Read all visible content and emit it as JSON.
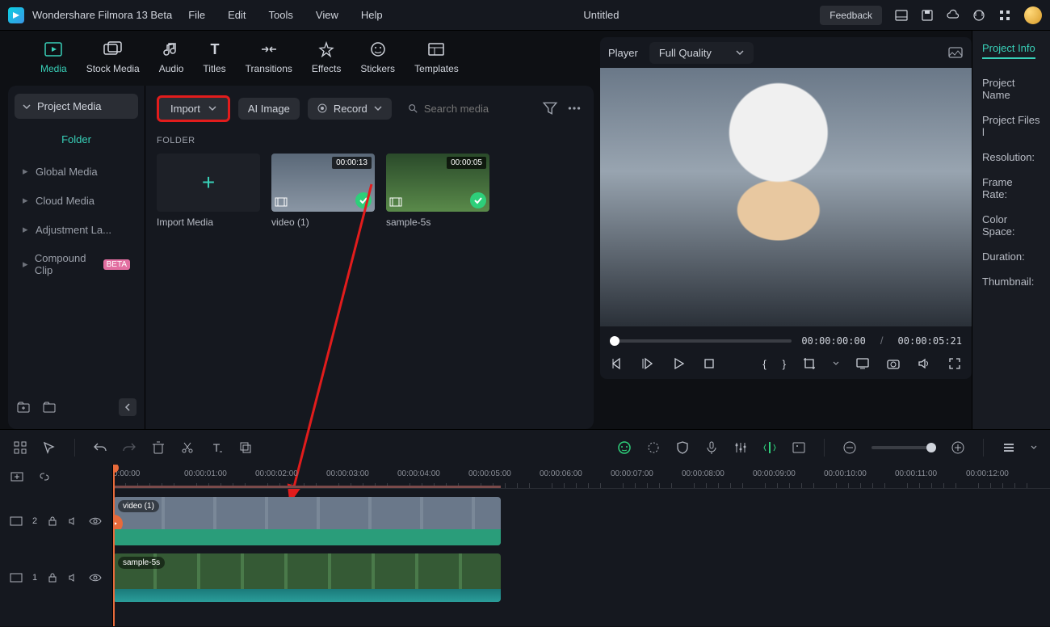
{
  "titlebar": {
    "app_name": "Wondershare Filmora 13 Beta",
    "menus": [
      "File",
      "Edit",
      "Tools",
      "View",
      "Help"
    ],
    "document_title": "Untitled",
    "feedback_label": "Feedback"
  },
  "category_tabs": {
    "items": [
      {
        "id": "media",
        "label": "Media",
        "active": true
      },
      {
        "id": "stock",
        "label": "Stock Media"
      },
      {
        "id": "audio",
        "label": "Audio"
      },
      {
        "id": "titles",
        "label": "Titles"
      },
      {
        "id": "transitions",
        "label": "Transitions"
      },
      {
        "id": "effects",
        "label": "Effects"
      },
      {
        "id": "stickers",
        "label": "Stickers"
      },
      {
        "id": "templates",
        "label": "Templates"
      }
    ]
  },
  "media_sidebar": {
    "project_media_label": "Project Media",
    "folder_label": "Folder",
    "items": [
      {
        "label": "Global Media"
      },
      {
        "label": "Cloud Media"
      },
      {
        "label": "Adjustment La..."
      },
      {
        "label": "Compound Clip",
        "beta": true
      }
    ]
  },
  "media_toolbar": {
    "import_label": "Import",
    "ai_image_label": "AI Image",
    "record_label": "Record",
    "search_placeholder": "Search media"
  },
  "folder_header": "FOLDER",
  "thumbs": {
    "import_media_label": "Import Media",
    "video1": {
      "label": "video (1)",
      "duration": "00:00:13"
    },
    "sample": {
      "label": "sample-5s",
      "duration": "00:00:05"
    }
  },
  "player": {
    "label": "Player",
    "quality_label": "Full Quality",
    "current_time": "00:00:00:00",
    "total_time": "00:00:05:21"
  },
  "inspector": {
    "tab_label": "Project Info",
    "rows": [
      "Project Name",
      "Project Files l",
      "Resolution:",
      "Frame Rate:",
      "Color Space:",
      "Duration:",
      "Thumbnail:"
    ]
  },
  "timeline": {
    "ruler_times": [
      "0:00:00",
      "00:00:01:00",
      "00:00:02:00",
      "00:00:03:00",
      "00:00:04:00",
      "00:00:05:00",
      "00:00:06:00",
      "00:00:07:00",
      "00:00:08:00",
      "00:00:09:00",
      "00:00:10:00",
      "00:00:11:00",
      "00:00:12:00"
    ],
    "track2_label": "2",
    "track1_label": "1",
    "clip1_label": "video (1)",
    "clip2_label": "sample-5s"
  }
}
